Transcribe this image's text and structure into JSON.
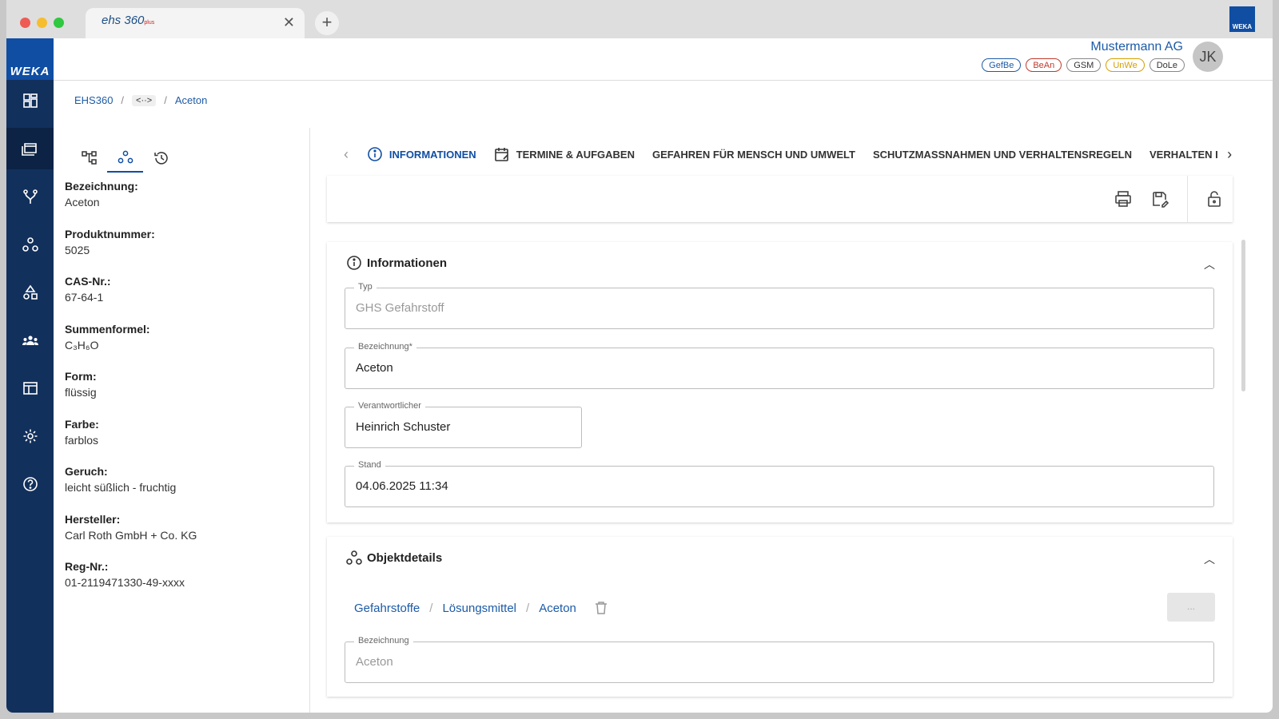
{
  "browser": {
    "tab_title": "ehs 360",
    "tab_title_suffix": "plus",
    "close_glyph": "✕",
    "new_tab_glyph": "+",
    "corner_logo": "WEKA"
  },
  "sidebar": {
    "logo": "WEKA",
    "items": [
      {
        "icon": "dashboard-icon"
      },
      {
        "icon": "folders-icon",
        "active": true
      },
      {
        "icon": "fork-icon"
      },
      {
        "icon": "objects-icon"
      },
      {
        "icon": "shapes-icon"
      },
      {
        "icon": "people-icon"
      },
      {
        "icon": "table-icon"
      },
      {
        "icon": "gear-icon"
      },
      {
        "icon": "help-icon"
      }
    ]
  },
  "header": {
    "company": "Mustermann AG",
    "badges": [
      {
        "label": "GefBe",
        "color": "#1d5ba6"
      },
      {
        "label": "BeAn",
        "color": "#c0392b"
      },
      {
        "label": "GSM",
        "color": "#333333"
      },
      {
        "label": "UnWe",
        "color": "#d4a000"
      },
      {
        "label": "DoLe",
        "color": "#333333"
      }
    ],
    "avatar_initials": "JK"
  },
  "breadcrumb": {
    "root": "EHS360",
    "code": "<··>",
    "current": "Aceton",
    "separator": "/"
  },
  "left_panel": {
    "properties": [
      {
        "label": "Bezeichnung",
        "value": "Aceton"
      },
      {
        "label": "Produktnummer",
        "value": "5025"
      },
      {
        "label": "CAS-Nr.",
        "value": "67-64-1"
      },
      {
        "label": "Summenformel",
        "value": "C₃H₆O"
      },
      {
        "label": "Form",
        "value": "flüssig"
      },
      {
        "label": "Farbe",
        "value": "farblos"
      },
      {
        "label": "Geruch",
        "value": "leicht süßlich - fruchtig"
      },
      {
        "label": "Hersteller",
        "value": "Carl Roth GmbH + Co. KG"
      },
      {
        "label": "Reg-Nr.",
        "value": "01-2119471330-49-xxxx"
      }
    ]
  },
  "main_tabs": {
    "prev_glyph": "‹",
    "next_glyph": "›",
    "tabs": [
      {
        "label": "INFORMATIONEN",
        "active": true
      },
      {
        "label": "TERMINE & AUFGABEN"
      },
      {
        "label": "GEFAHREN FÜR MENSCH UND UMWELT"
      },
      {
        "label": "SCHUTZMASSNAHMEN UND VERHALTENSREGELN"
      },
      {
        "label": "VERHALTEN I"
      }
    ]
  },
  "informationen": {
    "title": "Informationen",
    "chevron": "︿",
    "fields": {
      "typ": {
        "label": "Typ",
        "value": "GHS Gefahrstoff"
      },
      "bezeichnung": {
        "label": "Bezeichnung*",
        "value": "Aceton"
      },
      "verantwortlicher": {
        "label": "Verantwortlicher",
        "value": "Heinrich Schuster"
      },
      "stand": {
        "label": "Stand",
        "value": "04.06.2025 11:34"
      }
    }
  },
  "objektdetails": {
    "title": "Objektdetails",
    "chevron": "︿",
    "path": [
      "Gefahrstoffe",
      "Lösungsmittel",
      "Aceton"
    ],
    "separator": "/",
    "more_button": "...",
    "bezeichnung": {
      "label": "Bezeichnung",
      "value": "Aceton"
    }
  }
}
